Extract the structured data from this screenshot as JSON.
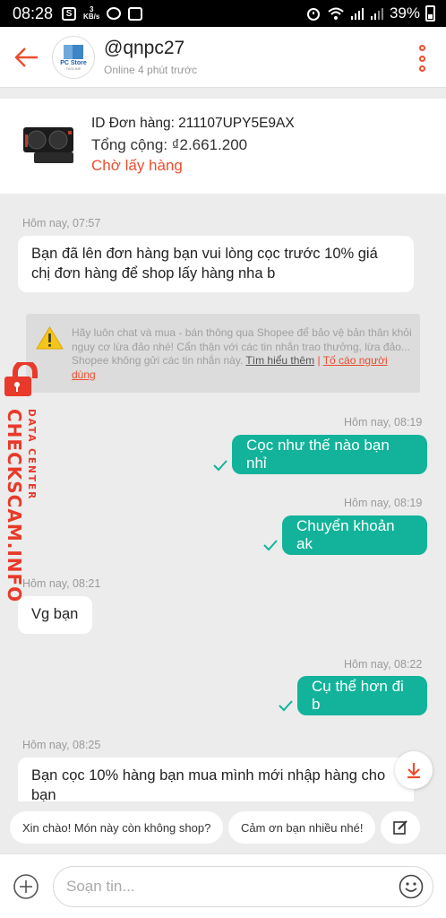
{
  "status_bar": {
    "time": "08:28",
    "kbs_top": "3",
    "kbs_bottom": "KB/s",
    "battery": "39%"
  },
  "header": {
    "shop_name": "@qnpc27",
    "online_status": "Online 4 phút trước",
    "avatar_brand": "PC Store",
    "avatar_tag": "TAGLINE"
  },
  "order": {
    "id_text": "ID Đơn hàng: 211107UPY5E9AX",
    "total_text": "Tổng cộng: ₫2.661.200",
    "status": "Chờ lấy hàng"
  },
  "messages": [
    {
      "time": "Hôm nay, 07:57",
      "direction": "in",
      "text": "Bạn đã lên đơn hàng bạn vui lòng cọc trước 10% giá chị đơn hàng để shop lấy hàng nha b"
    },
    {
      "time": "Hôm nay, 08:19",
      "direction": "out",
      "text": "Cọc như thế nào bạn nhỉ"
    },
    {
      "time": "Hôm nay, 08:19",
      "direction": "out",
      "text": "Chuyển khoản ak"
    },
    {
      "time": "Hôm nay, 08:21",
      "direction": "in",
      "text": "Vg bạn"
    },
    {
      "time": "Hôm nay, 08:22",
      "direction": "out",
      "text": "Cụ thể hơn đi b"
    },
    {
      "time": "Hôm nay, 08:25",
      "direction": "in",
      "text": "Bạn cọc 10% hàng bạn mua mình mới nhập hàng cho bạn"
    }
  ],
  "warning": {
    "text": "Hãy luôn chat và mua - bán thông qua Shopee để bảo vệ bản thân khỏi nguy cơ lừa đảo nhé! Cẩn thận với các tin nhắn trao thưởng, lừa đảo... Shopee không gửi các tin nhắn này.",
    "learn_more": "Tìm hiểu thêm",
    "separator": "|",
    "report": "Tố cáo người dùng"
  },
  "watermark": {
    "big": "CHECKSCAM.INFO",
    "small": "DATA CENTER"
  },
  "quick_replies": [
    "Xin chào! Món này còn không shop?",
    "Cảm ơn bạn nhiều nhé!"
  ],
  "input": {
    "placeholder": "Soạn tin..."
  },
  "colors": {
    "accent": "#ee4d2d",
    "outgoing": "#12b39a",
    "tick": "#12b39a"
  },
  "icons": [
    "back-arrow-icon",
    "more-icon",
    "warning-icon",
    "check-icon",
    "scroll-down-icon",
    "edit-icon",
    "plus-icon",
    "emoji-icon"
  ]
}
